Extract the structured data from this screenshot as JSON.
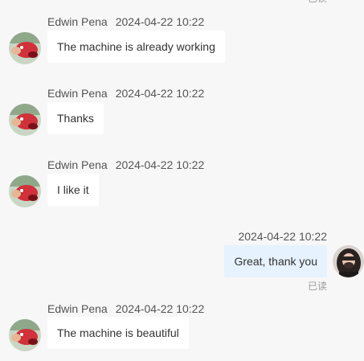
{
  "conversation": {
    "top_read_status": "已读",
    "messages": [
      {
        "sender": "Edwin Pena",
        "time": "2024-04-22 10:22",
        "text": "The machine is already working",
        "direction": "in"
      },
      {
        "sender": "Edwin Pena",
        "time": "2024-04-22 10:22",
        "text": "Thanks",
        "direction": "in"
      },
      {
        "sender": "Edwin Pena",
        "time": "2024-04-22 10:22",
        "text": "I like it",
        "direction": "in"
      },
      {
        "sender": "",
        "time": "2024-04-22 10:22",
        "text": "Great, thank you",
        "direction": "out",
        "read_status": "已读"
      },
      {
        "sender": "Edwin Pena",
        "time": "2024-04-22 10:22",
        "text": "The machine is beautiful",
        "direction": "in"
      }
    ]
  },
  "colors": {
    "background": "#f7f7f8",
    "incoming_bubble": "#ffffff",
    "outgoing_bubble": "#e6f2fe",
    "read_status": "#9a9a9a"
  },
  "icons": {
    "contact_avatar": "red-character-avatar",
    "self_avatar": "user-photo-avatar"
  }
}
